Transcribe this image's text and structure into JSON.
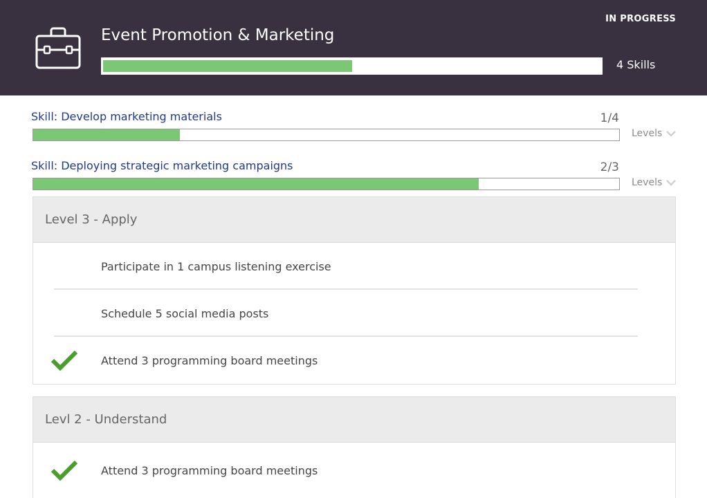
{
  "header": {
    "title": "Event Promotion & Marketing",
    "status": "IN PROGRESS",
    "skills_count": "4 Skills",
    "progress_fraction": 0.5,
    "icon": "briefcase-icon"
  },
  "skills": [
    {
      "title": "Skill: Develop marketing materials",
      "ratio": "1/4",
      "progress_fraction": 0.25,
      "levels_label": "Levels"
    },
    {
      "title": "Skill: Deploying strategic marketing campaigns",
      "ratio": "2/3",
      "progress_fraction": 0.76,
      "levels_label": "Levels"
    }
  ],
  "levels": [
    {
      "title": "Level 3 - Apply",
      "tasks": [
        {
          "text": "Participate in 1 campus listening exercise",
          "completed": false
        },
        {
          "text": "Schedule 5 social media posts",
          "completed": false
        },
        {
          "text": "Attend 3 programming board meetings",
          "completed": true
        }
      ]
    },
    {
      "title": "Levl 2 - Understand",
      "tasks": [
        {
          "text": "Attend 3 programming board meetings",
          "completed": true
        }
      ]
    }
  ],
  "colors": {
    "header_bg": "#3a3140",
    "progress_fill": "#7ac774",
    "check": "#4a9e2a",
    "skill_title": "#1f3a8a"
  }
}
